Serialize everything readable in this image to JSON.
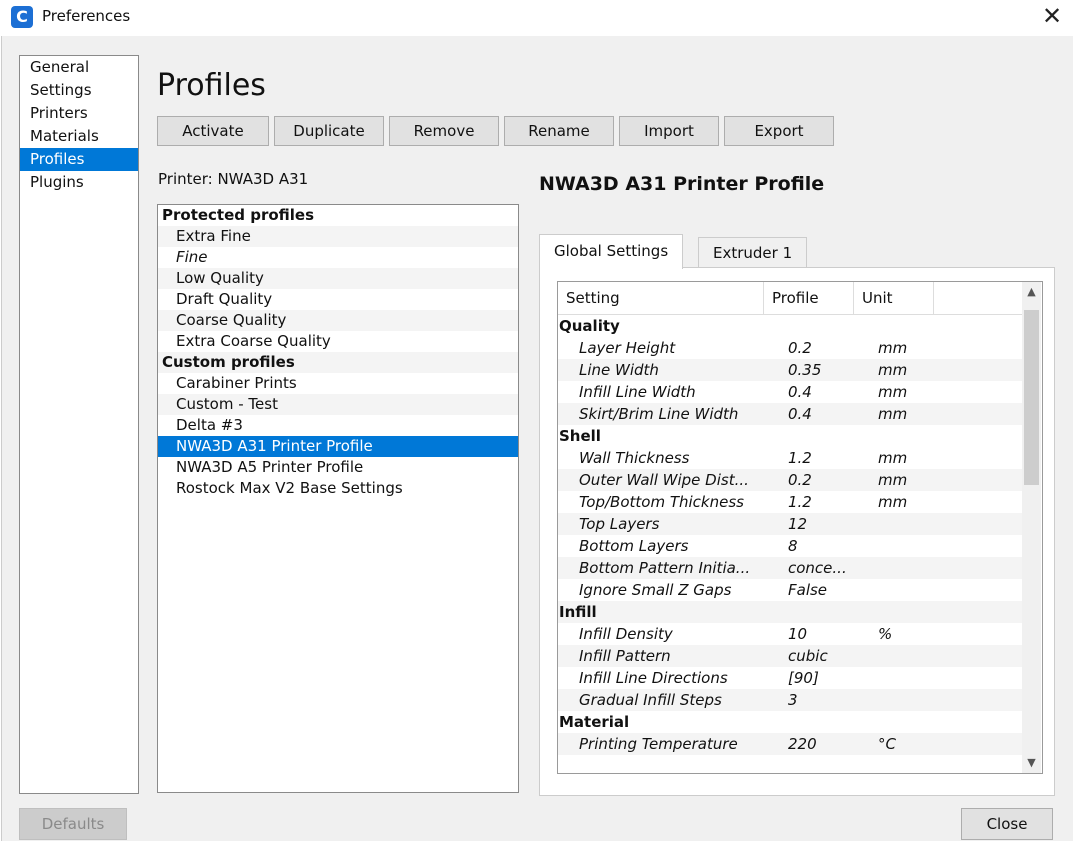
{
  "window": {
    "title": "Preferences",
    "close_glyph": "✕",
    "app_icon": "cura-logo-icon"
  },
  "nav": {
    "items": [
      {
        "label": "General"
      },
      {
        "label": "Settings"
      },
      {
        "label": "Printers"
      },
      {
        "label": "Materials"
      },
      {
        "label": "Profiles",
        "selected": true
      },
      {
        "label": "Plugins"
      }
    ]
  },
  "page_title": "Profiles",
  "toolbar": {
    "activate": "Activate",
    "duplicate": "Duplicate",
    "remove": "Remove",
    "rename": "Rename",
    "import": "Import",
    "export": "Export"
  },
  "printer_label": "Printer: NWA3D A31",
  "profiles": {
    "protected_header": "Protected profiles",
    "protected": [
      "Extra Fine",
      "Fine",
      "Low Quality",
      "Draft Quality",
      "Coarse Quality",
      "Extra Coarse Quality"
    ],
    "custom_header": "Custom profiles",
    "custom": [
      "Carabiner Prints",
      "Custom - Test",
      "Delta #3",
      "NWA3D A31 Printer Profile",
      "NWA3D A5 Printer Profile",
      "Rostock Max V2 Base Settings"
    ],
    "selected": "NWA3D A31 Printer Profile"
  },
  "profile_heading": "NWA3D A31 Printer Profile",
  "tabs": {
    "global": "Global Settings",
    "extruder": "Extruder 1"
  },
  "settings_table": {
    "headers": {
      "setting": "Setting",
      "profile": "Profile",
      "unit": "Unit"
    },
    "sections": [
      {
        "name": "Quality",
        "rows": [
          {
            "setting": "Layer Height",
            "profile": "0.2",
            "unit": "mm"
          },
          {
            "setting": "Line Width",
            "profile": "0.35",
            "unit": "mm"
          },
          {
            "setting": "Infill Line Width",
            "profile": "0.4",
            "unit": "mm"
          },
          {
            "setting": "Skirt/Brim Line Width",
            "profile": "0.4",
            "unit": "mm"
          }
        ]
      },
      {
        "name": "Shell",
        "rows": [
          {
            "setting": "Wall Thickness",
            "profile": "1.2",
            "unit": "mm"
          },
          {
            "setting": "Outer Wall Wipe Dist...",
            "profile": "0.2",
            "unit": "mm"
          },
          {
            "setting": "Top/Bottom Thickness",
            "profile": "1.2",
            "unit": "mm"
          },
          {
            "setting": "Top Layers",
            "profile": "12",
            "unit": ""
          },
          {
            "setting": "Bottom Layers",
            "profile": "8",
            "unit": ""
          },
          {
            "setting": "Bottom Pattern Initia...",
            "profile": "conce...",
            "unit": ""
          },
          {
            "setting": "Ignore Small Z Gaps",
            "profile": "False",
            "unit": ""
          }
        ]
      },
      {
        "name": "Infill",
        "rows": [
          {
            "setting": "Infill Density",
            "profile": "10",
            "unit": "%"
          },
          {
            "setting": "Infill Pattern",
            "profile": "cubic",
            "unit": ""
          },
          {
            "setting": "Infill Line Directions",
            "profile": "[90]",
            "unit": ""
          },
          {
            "setting": "Gradual Infill Steps",
            "profile": "3",
            "unit": ""
          }
        ]
      },
      {
        "name": "Material",
        "rows": [
          {
            "setting": "Printing Temperature",
            "profile": "220",
            "unit": "°C"
          }
        ]
      }
    ]
  },
  "buttons": {
    "defaults": "Defaults",
    "close": "Close"
  },
  "colors": {
    "selection": "#0078d7",
    "window_bg": "#f0f0f0"
  }
}
